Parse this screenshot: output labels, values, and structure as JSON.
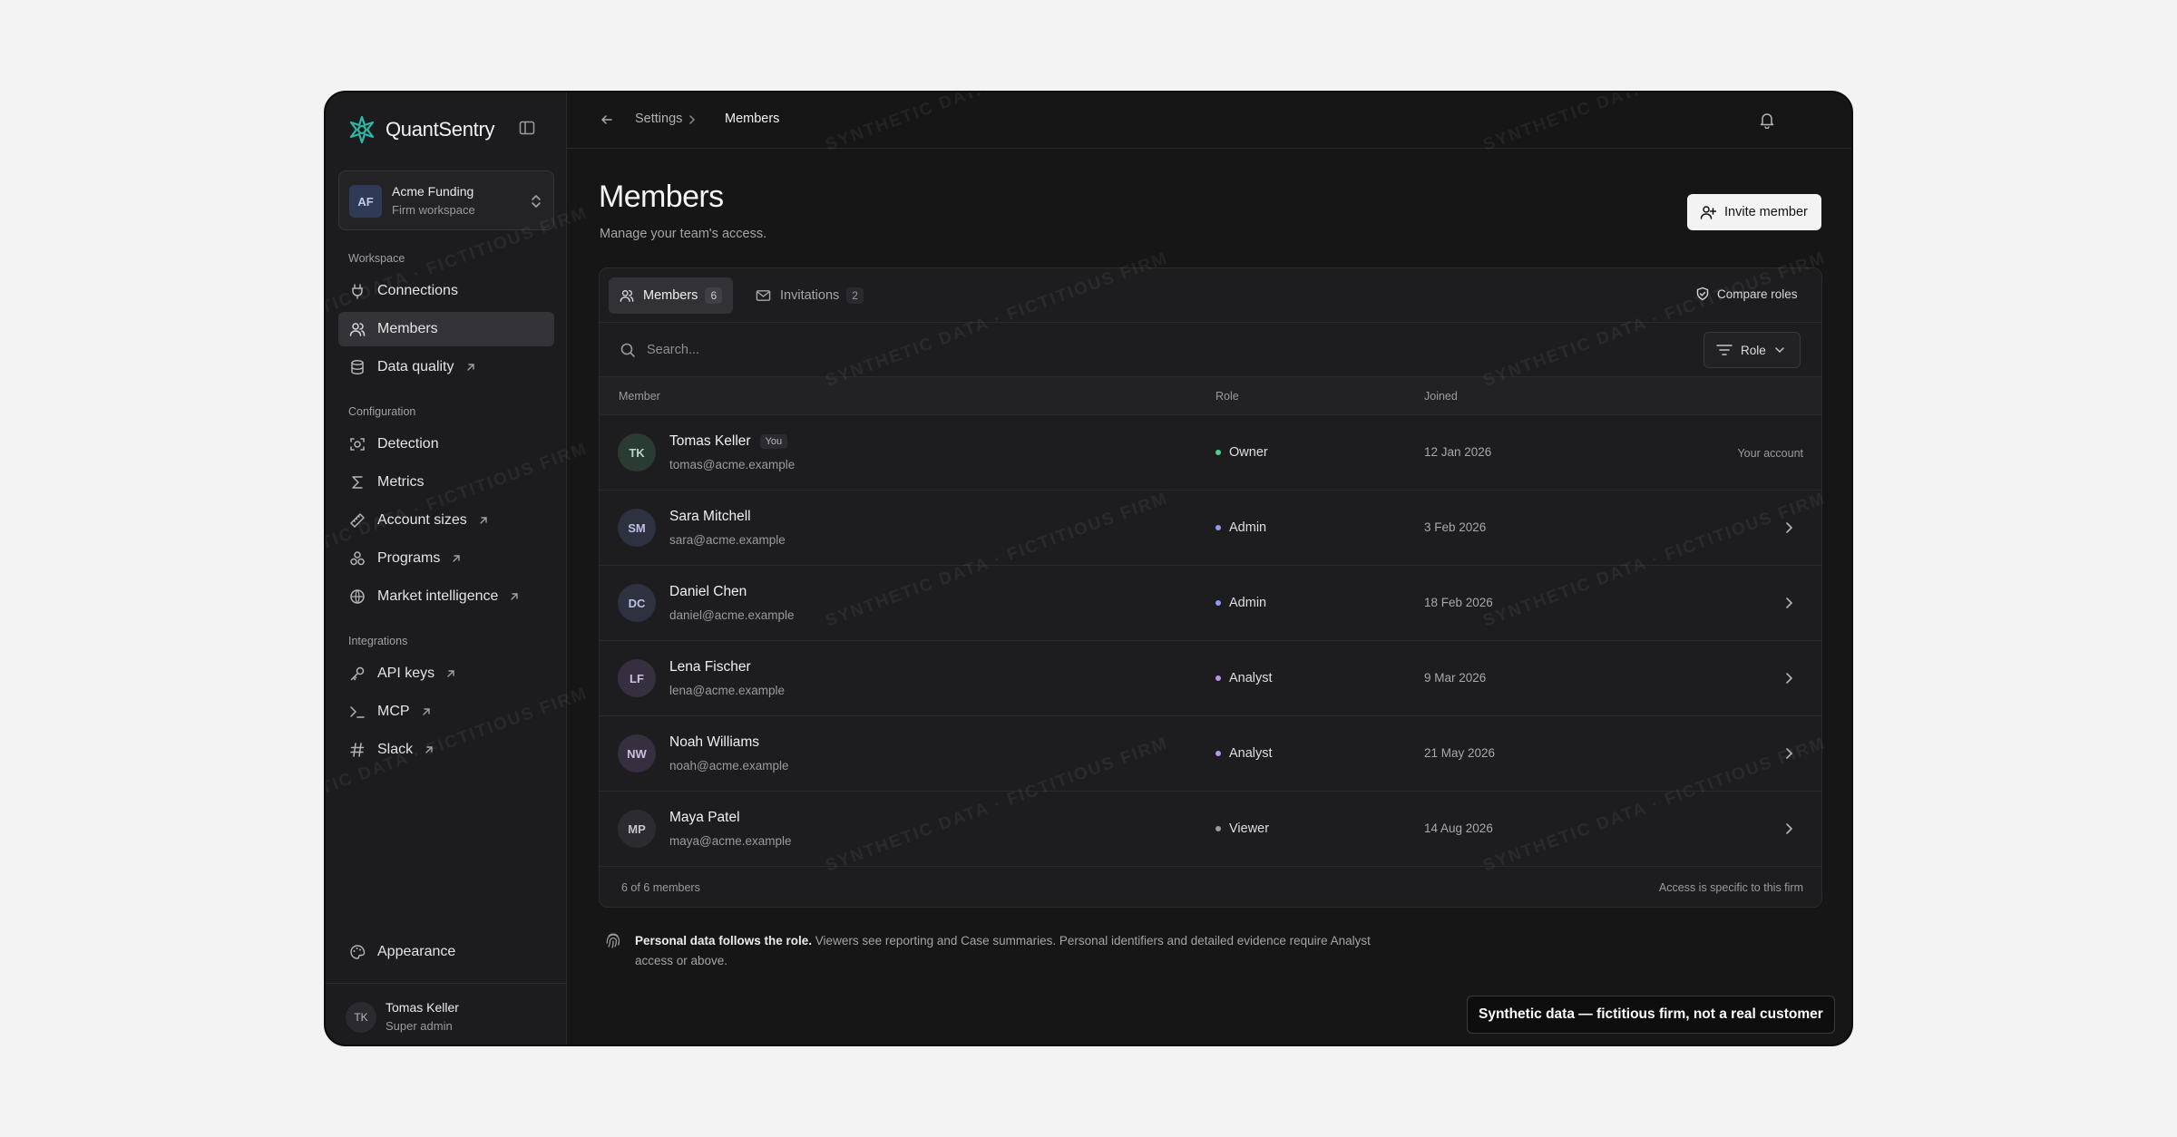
{
  "brand": {
    "name": "QuantSentry"
  },
  "workspace": {
    "initials": "AF",
    "name": "Acme Funding",
    "subtitle": "Firm workspace"
  },
  "sidebar": {
    "groups": [
      {
        "label": "Workspace"
      },
      {
        "label": "Configuration"
      },
      {
        "label": "Integrations"
      }
    ],
    "items": [
      {
        "label": "Connections",
        "icon": "plug-icon",
        "external": false
      },
      {
        "label": "Members",
        "icon": "users-icon",
        "external": false,
        "active": true
      },
      {
        "label": "Data quality",
        "icon": "database-icon",
        "external": true
      },
      {
        "label": "Detection",
        "icon": "scan-icon",
        "external": false
      },
      {
        "label": "Metrics",
        "icon": "sigma-icon",
        "external": false
      },
      {
        "label": "Account sizes",
        "icon": "ruler-icon",
        "external": true
      },
      {
        "label": "Programs",
        "icon": "shapes-icon",
        "external": true
      },
      {
        "label": "Market intelligence",
        "icon": "globe-icon",
        "external": true
      },
      {
        "label": "API keys",
        "icon": "key-icon",
        "external": true
      },
      {
        "label": "MCP",
        "icon": "terminal-icon",
        "external": true
      },
      {
        "label": "Slack",
        "icon": "hash-icon",
        "external": true
      }
    ],
    "appearance": {
      "label": "Appearance",
      "icon": "palette-icon"
    },
    "user": {
      "initials": "TK",
      "name": "Tomas Keller",
      "role": "Super admin"
    }
  },
  "header": {
    "crumb_parent": "Settings",
    "crumb_current": "Members"
  },
  "page": {
    "title": "Members",
    "subtitle": "Manage your team's access.",
    "invite_label": "Invite member"
  },
  "tabs": [
    {
      "label": "Members",
      "count": "6",
      "active": true
    },
    {
      "label": "Invitations",
      "count": "2",
      "active": false
    }
  ],
  "compare_label": "Compare roles",
  "search": {
    "placeholder": "Search..."
  },
  "role_filter": {
    "label": "Role"
  },
  "table": {
    "columns": [
      "Member",
      "Role",
      "Joined"
    ],
    "rows": [
      {
        "initials": "TK",
        "name": "Tomas Keller",
        "you": "You",
        "email": "tomas@acme.example",
        "role": "Owner",
        "joined": "12 Jan 2026",
        "action": "Your account",
        "avatar_bg": "#2a3b33",
        "avatar_fg": "#b7d8c4",
        "dot": "#4ccf8f"
      },
      {
        "initials": "SM",
        "name": "Sara Mitchell",
        "email": "sara@acme.example",
        "role": "Admin",
        "joined": "3 Feb 2026",
        "avatar_bg": "#2e3140",
        "avatar_fg": "#bcc2e0",
        "dot": "#8c9cf5"
      },
      {
        "initials": "DC",
        "name": "Daniel Chen",
        "email": "daniel@acme.example",
        "role": "Admin",
        "joined": "18 Feb 2026",
        "avatar_bg": "#2e3140",
        "avatar_fg": "#bcc2e0",
        "dot": "#8c9cf5"
      },
      {
        "initials": "LF",
        "name": "Lena Fischer",
        "email": "lena@acme.example",
        "role": "Analyst",
        "joined": "9 Mar 2026",
        "avatar_bg": "#352f40",
        "avatar_fg": "#cdbfe2",
        "dot": "#b894f0"
      },
      {
        "initials": "NW",
        "name": "Noah Williams",
        "email": "noah@acme.example",
        "role": "Analyst",
        "joined": "21 May 2026",
        "avatar_bg": "#352f40",
        "avatar_fg": "#cdbfe2",
        "dot": "#b894f0"
      },
      {
        "initials": "MP",
        "name": "Maya Patel",
        "email": "maya@acme.example",
        "role": "Viewer",
        "joined": "14 Aug 2026",
        "avatar_bg": "#2c2c30",
        "avatar_fg": "#c4c4c9",
        "dot": "#9a9aa0"
      }
    ],
    "footer_count": "6 of 6 members",
    "footer_note": "Access is specific to this firm"
  },
  "note": {
    "bold": "Personal data follows the role.",
    "text": " Viewers see reporting and Case summaries. Personal identifiers and detailed evidence require Analyst access or above."
  },
  "synthetic_banner": "Synthetic data — fictitious firm, not a real customer",
  "watermark": "SYNTHETIC DATA · FICTITIOUS FIRM",
  "colors": {
    "accent": "#2fb8a6",
    "background": "#161617",
    "sidebar": "#1c1c1e"
  }
}
